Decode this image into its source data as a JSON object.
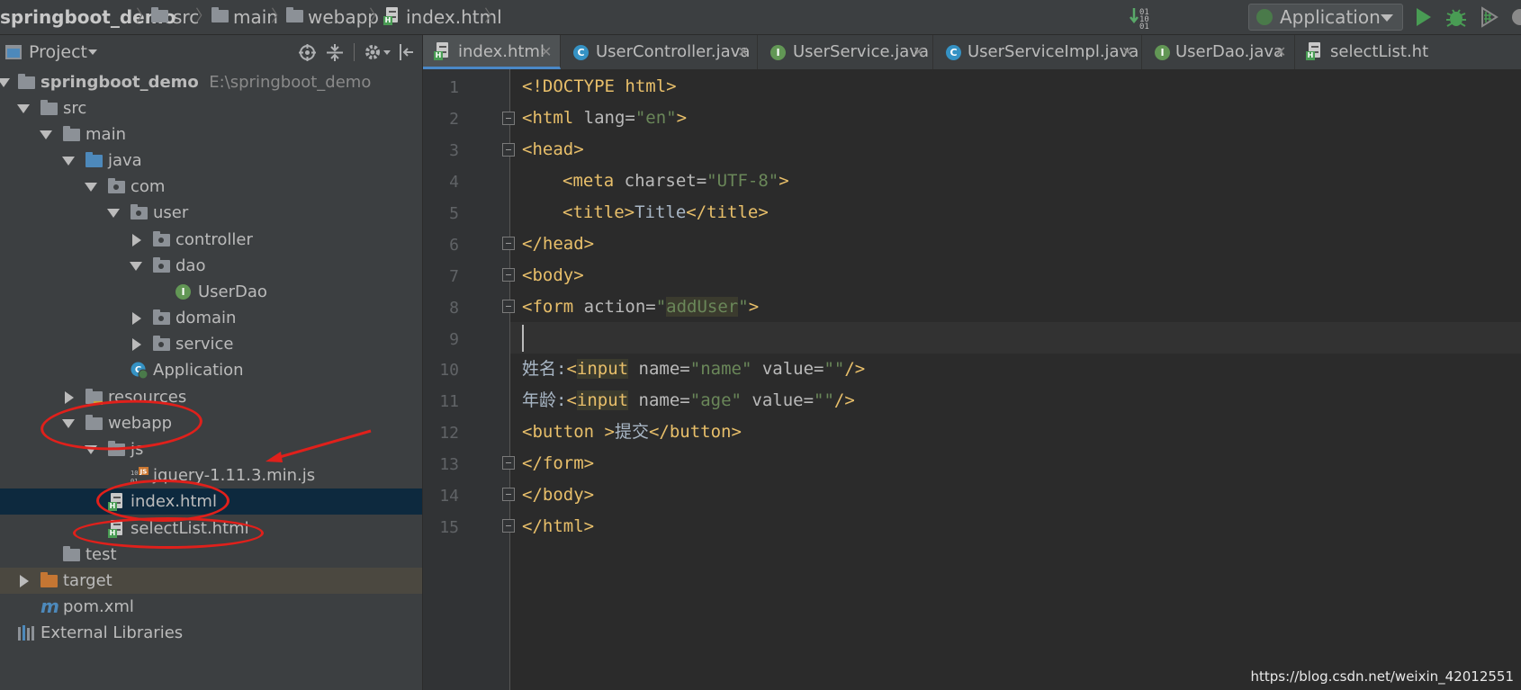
{
  "breadcrumb": {
    "project": "springboot_demo",
    "src": "src",
    "main": "main",
    "webapp": "webapp",
    "file": "index.html"
  },
  "toolbar": {
    "run_config": "Application"
  },
  "project_panel": {
    "title": "Project",
    "tree": {
      "root_name": "springboot_demo",
      "root_path": "E:\\springboot_demo",
      "src": "src",
      "main": "main",
      "java": "java",
      "com": "com",
      "user": "user",
      "controller": "controller",
      "dao": "dao",
      "userdao": "UserDao",
      "domain": "domain",
      "service": "service",
      "application": "Application",
      "resources": "resources",
      "webapp": "webapp",
      "js": "js",
      "jquery": "jquery-1.11.3.min.js",
      "index_html": "index.html",
      "selectlist_html": "selectList.html",
      "test": "test",
      "target": "target",
      "pom": "pom.xml",
      "external_libraries": "External Libraries"
    }
  },
  "tabs": [
    {
      "label": "index.html",
      "icon": "html-file-icon",
      "active": true
    },
    {
      "label": "UserController.java",
      "icon": "class-icon"
    },
    {
      "label": "UserService.java",
      "icon": "interface-icon"
    },
    {
      "label": "UserServiceImpl.java",
      "icon": "class-icon"
    },
    {
      "label": "UserDao.java",
      "icon": "interface-icon"
    },
    {
      "label": "selectList.ht",
      "icon": "html-file-icon"
    }
  ],
  "editor": {
    "line_numbers": [
      "1",
      "2",
      "3",
      "4",
      "5",
      "6",
      "7",
      "8",
      "9",
      "10",
      "11",
      "12",
      "13",
      "14",
      "15"
    ],
    "line1": {
      "a": "<!DOCTYPE html>"
    },
    "line2": {
      "a": "<html",
      "b": " lang=",
      "c": "\"en\"",
      "d": ">"
    },
    "line3": {
      "a": "<head>"
    },
    "line4": {
      "a": "<meta",
      "b": " charset=",
      "c": "\"UTF-8\"",
      "d": ">"
    },
    "line5": {
      "a": "<title>",
      "b": "Title",
      "c": "</title>"
    },
    "line6": {
      "a": "</head>"
    },
    "line7": {
      "a": "<body>"
    },
    "line8": {
      "a": "<form",
      "b": " action=",
      "c": "\"",
      "d": "addUser",
      "e": "\"",
      "f": ">"
    },
    "line10": {
      "a": "姓名:",
      "b": "<",
      "c": "input",
      "d": " name=",
      "e": "\"name\"",
      "f": " value=",
      "g": "\"\"",
      "h": "/>"
    },
    "line11": {
      "a": "年龄:",
      "b": "<",
      "c": "input",
      "d": " name=",
      "e": "\"age\"",
      "f": " value=",
      "g": "\"\"",
      "h": "/>"
    },
    "line12": {
      "a": "<button ",
      "b": ">",
      "c": "提交",
      "d": "</button>"
    },
    "line13": {
      "a": "</form>"
    },
    "line14": {
      "a": "</body>"
    },
    "line15": {
      "a": "</html>"
    }
  },
  "watermark": "https://blog.csdn.net/weixin_42012551",
  "colors": {
    "annotation_red": "#e0201b",
    "selection_blue": "#0d293e",
    "tag_color": "#e8bf6a",
    "string_color": "#6a8759"
  }
}
